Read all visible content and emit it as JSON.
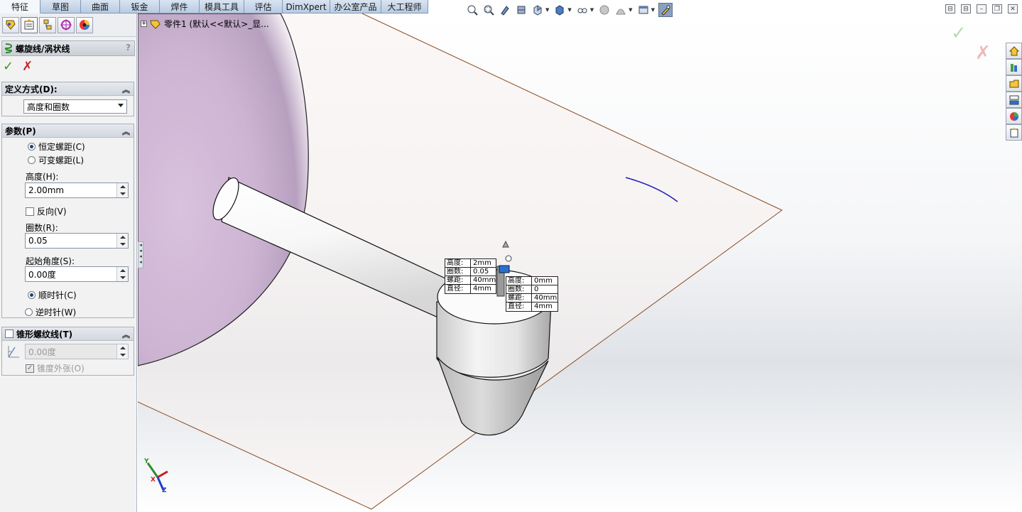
{
  "tabs": [
    {
      "label": "特征",
      "active": true
    },
    {
      "label": "草图"
    },
    {
      "label": "曲面"
    },
    {
      "label": "钣金"
    },
    {
      "label": "焊件"
    },
    {
      "label": "模具工具"
    },
    {
      "label": "评估"
    },
    {
      "label": "DimXpert"
    },
    {
      "label": "办公室产品"
    },
    {
      "label": "大工程师"
    }
  ],
  "panel_icons": [
    "feature-manager-icon",
    "property-manager-icon",
    "configuration-manager-icon",
    "dimxpert-manager-icon",
    "display-manager-icon"
  ],
  "property_manager": {
    "title": "螺旋线/涡状线",
    "help": "?",
    "ok": "✓",
    "cancel": "✗",
    "definition": {
      "header": "定义方式(D):",
      "selected": "高度和圈数"
    },
    "parameters": {
      "header": "参数(P)",
      "constant_pitch": "恒定螺距(C)",
      "variable_pitch": "可变螺距(L)",
      "height_label": "高度(H):",
      "height_value": "2.00mm",
      "reverse_label": "反向(V)",
      "revolutions_label": "圈数(R):",
      "revolutions_value": "0.05",
      "start_angle_label": "起始角度(S):",
      "start_angle_value": "0.00度",
      "clockwise": "顺时针(C)",
      "counterclockwise": "逆时针(W)"
    },
    "taper": {
      "header": "锥形螺纹线(T)",
      "angle_value": "0.00度",
      "outward_label": "锥度外张(O)"
    }
  },
  "tree_label": "零件1 (默认<<默认>_显...",
  "view_toolbar": [
    "zoom-to-fit-icon",
    "zoom-to-area-icon",
    "previous-view-icon",
    "section-view-icon",
    "view-orientation-icon",
    "display-style-icon",
    "hide-show-items-icon",
    "edit-appearance-icon",
    "apply-scene-icon",
    "view-settings-icon",
    "sketch-highlight-icon"
  ],
  "callout_left": [
    {
      "k": "高度:",
      "v": "2mm"
    },
    {
      "k": "圈数:",
      "v": "0.05"
    },
    {
      "k": "螺距:",
      "v": "40mm"
    },
    {
      "k": "直径:",
      "v": "4mm"
    }
  ],
  "callout_right": [
    {
      "k": "高度:",
      "v": "0mm"
    },
    {
      "k": "圈数:",
      "v": "0"
    },
    {
      "k": "螺距:",
      "v": "40mm"
    },
    {
      "k": "直径:",
      "v": "4mm"
    }
  ],
  "triad": {
    "x": "X",
    "y": "Y",
    "z": "Z"
  },
  "colors": {
    "accent": "#1f3f7a",
    "plane_edge": "#8b4a1f",
    "helix": "#1d1db8",
    "ok": "#3a9b28",
    "cancel": "#c8242a"
  }
}
